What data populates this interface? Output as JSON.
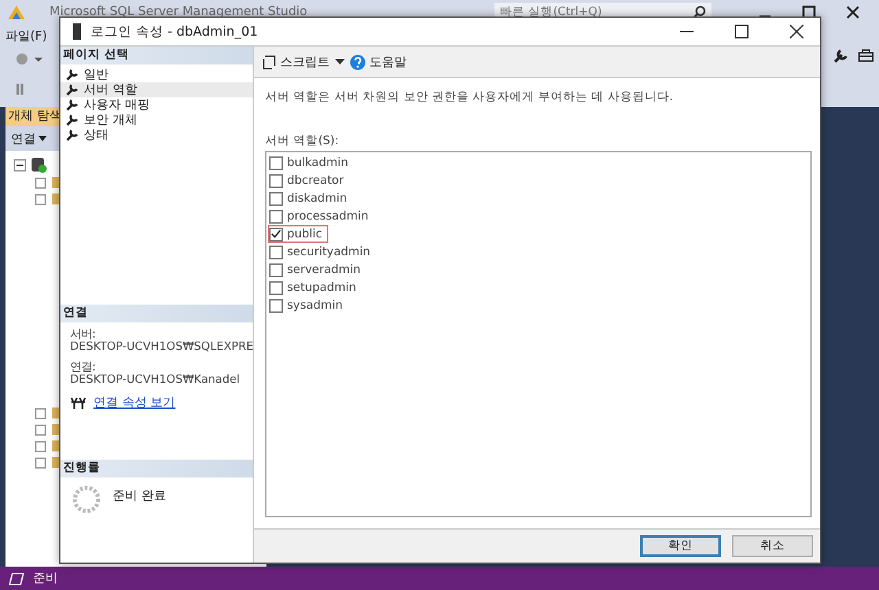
{
  "background_window": {
    "title": "Microsoft SQL Server Management Studio",
    "quick_launch": {
      "placeholder": "빠른 실행(Ctrl+Q)"
    },
    "menu": [
      "파일(F)"
    ],
    "object_explorer": {
      "title": "개체 탐색",
      "connect": "연결",
      "tree": [
        {
          "expanded": true
        }
      ]
    }
  },
  "dialog": {
    "title": "로그인 속성 - dbAdmin_01",
    "page_select": {
      "title": "페이지 선택",
      "items": [
        {
          "label": "일반",
          "selected": false
        },
        {
          "label": "서버 역할",
          "selected": true
        },
        {
          "label": "사용자 매핑",
          "selected": false
        },
        {
          "label": "보안 개체",
          "selected": false
        },
        {
          "label": "상태",
          "selected": false
        }
      ]
    },
    "connection": {
      "title": "연결",
      "server_label": "서버:",
      "server": "DESKTOP-UCVH1OS₩SQLEXPRE",
      "connection_label": "연결:",
      "connection": "DESKTOP-UCVH1OS₩Kanadel",
      "link": "연결 속성 보기"
    },
    "progress": {
      "title": "진행률",
      "status": "준비 완료"
    },
    "toolbar": {
      "script": "스크립트",
      "help": "도움말"
    },
    "description": "서버 역할은 서버 차원의 보안 권한을 사용자에게 부여하는 데 사용됩니다.",
    "roles_label": "서버 역할(S):",
    "roles": [
      {
        "name": "bulkadmin",
        "checked": false,
        "focused": false
      },
      {
        "name": "dbcreator",
        "checked": false,
        "focused": false
      },
      {
        "name": "diskadmin",
        "checked": false,
        "focused": false
      },
      {
        "name": "processadmin",
        "checked": false,
        "focused": false
      },
      {
        "name": "public",
        "checked": true,
        "focused": true
      },
      {
        "name": "securityadmin",
        "checked": false,
        "focused": false
      },
      {
        "name": "serveradmin",
        "checked": false,
        "focused": false
      },
      {
        "name": "setupadmin",
        "checked": false,
        "focused": false
      },
      {
        "name": "sysadmin",
        "checked": false,
        "focused": false
      }
    ],
    "buttons": [
      {
        "label": "확인",
        "default": true
      },
      {
        "label": "취소",
        "default": false
      }
    ]
  },
  "status_bar": {
    "text": "준비"
  }
}
